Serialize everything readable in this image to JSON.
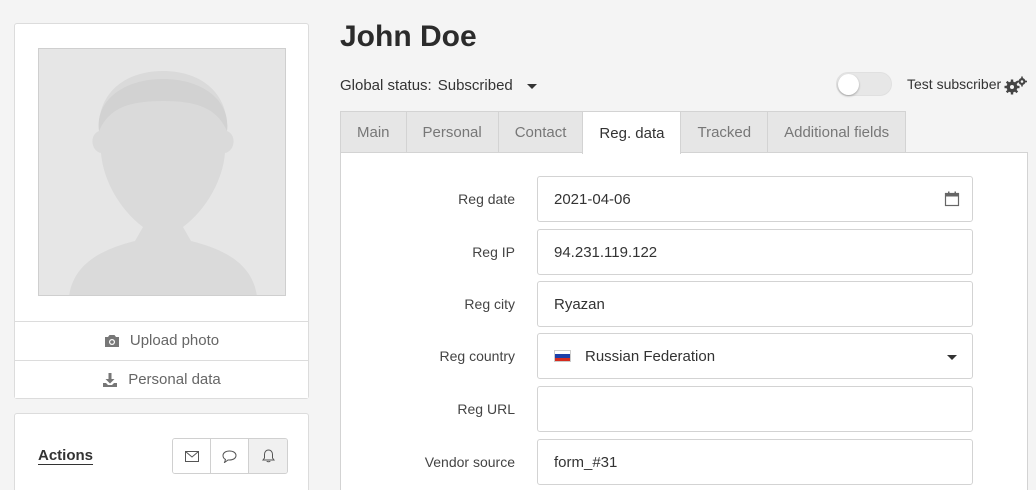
{
  "profile": {
    "name": "John Doe",
    "upload_label": "Upload photo",
    "personal_data_label": "Personal data"
  },
  "actions": {
    "title": "Actions",
    "buttons": [
      "mail-icon",
      "chat-icon",
      "bell-icon"
    ]
  },
  "status": {
    "label": "Global status:",
    "value": "Subscribed",
    "test_subscriber_label": "Test subscriber",
    "test_subscriber_on": false
  },
  "tabs": [
    {
      "label": "Main",
      "active": false
    },
    {
      "label": "Personal",
      "active": false
    },
    {
      "label": "Contact",
      "active": false
    },
    {
      "label": "Reg. data",
      "active": true
    },
    {
      "label": "Tracked",
      "active": false
    },
    {
      "label": "Additional fields",
      "active": false
    }
  ],
  "fields": {
    "reg_date": {
      "label": "Reg date",
      "value": "2021-04-06"
    },
    "reg_ip": {
      "label": "Reg IP",
      "value": "94.231.119.122"
    },
    "reg_city": {
      "label": "Reg city",
      "value": "Ryazan"
    },
    "reg_country": {
      "label": "Reg country",
      "value": "Russian Federation",
      "flag_colors": [
        "#ffffff",
        "#1c3fa8",
        "#d52b1e"
      ]
    },
    "reg_url": {
      "label": "Reg URL",
      "value": ""
    },
    "vendor_source": {
      "label": "Vendor source",
      "value": "form_#31"
    }
  },
  "colors": {
    "background": "#f4f4f4",
    "panel": "#ffffff",
    "tab_inactive": "#e6e6e6"
  }
}
